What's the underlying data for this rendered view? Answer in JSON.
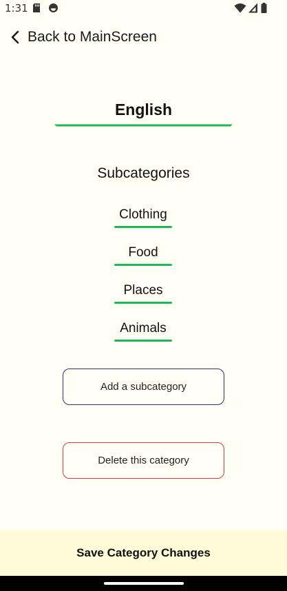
{
  "status_bar": {
    "time": "1:31",
    "icons_left": [
      "sd-card-icon",
      "sync-icon"
    ],
    "icons_right": [
      "wifi-icon",
      "signal-icon",
      "battery-icon"
    ]
  },
  "nav": {
    "back_label": "Back to MainScreen",
    "back_icon": "chevron-left-icon"
  },
  "category": {
    "name": "English",
    "underline_color": "#1DB954"
  },
  "subcategories": {
    "heading": "Subcategories",
    "items": [
      {
        "label": "Clothing"
      },
      {
        "label": "Food"
      },
      {
        "label": "Places"
      },
      {
        "label": "Animals"
      }
    ]
  },
  "actions": {
    "add_label": "Add a subcategory",
    "add_border_color": "#2E2A8C",
    "delete_label": "Delete this category",
    "delete_border_color": "#E53935"
  },
  "footer": {
    "save_label": "Save Category Changes",
    "background_color": "#FFFAD8"
  }
}
